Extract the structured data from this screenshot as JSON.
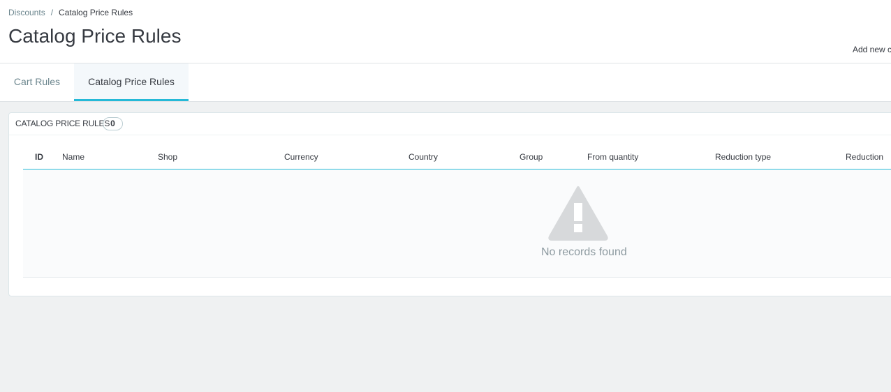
{
  "breadcrumb": {
    "parent": "Discounts",
    "separator": "/",
    "current": "Catalog Price Rules"
  },
  "page": {
    "title": "Catalog Price Rules",
    "add_new_label": "Add new c"
  },
  "tabs": [
    {
      "label": "Cart Rules",
      "active": false
    },
    {
      "label": "Catalog Price Rules",
      "active": true
    }
  ],
  "panel": {
    "title": "CATALOG PRICE RULES",
    "count": "0"
  },
  "table": {
    "columns": [
      "ID",
      "Name",
      "Shop",
      "Currency",
      "Country",
      "Group",
      "From quantity",
      "Reduction type",
      "Reduction"
    ]
  },
  "empty_state": {
    "message": "No records found",
    "icon": "warning-icon"
  },
  "colors": {
    "accent": "#25b9d7",
    "text": "#363a41",
    "muted": "#6c868e",
    "background": "#eff1f2"
  }
}
